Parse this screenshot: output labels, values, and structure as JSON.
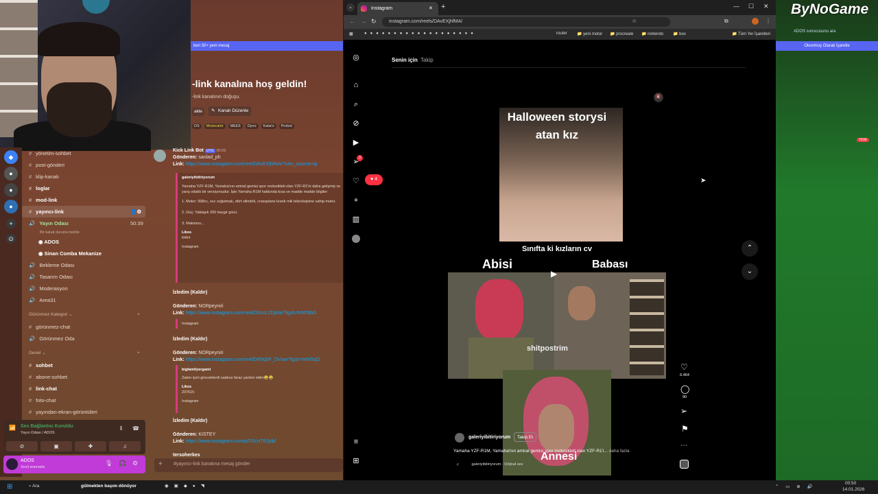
{
  "discord": {
    "welcome": "-link kanalına hoş geldin!",
    "welcome_sub": "-link kanalının doğuşu.",
    "banner": "beri 30+ yeni mesaj",
    "edit_channel": "Kanalı Düzenle",
    "edit_left": "akle",
    "tags": [
      "DS",
      "Moderatör",
      "MEE6",
      "Dyno",
      "Kalai's",
      "Probot"
    ],
    "channels": [
      {
        "name": "yönetim-sohbet",
        "bold": false
      },
      {
        "name": "post-gönderi",
        "bold": false
      },
      {
        "name": "klip-kanalı",
        "bold": false
      },
      {
        "name": "loglar",
        "bold": true
      },
      {
        "name": "mod-link",
        "bold": true
      },
      {
        "name": "yayıncı-link",
        "bold": true
      }
    ],
    "voice_channel": "Yayın Odası",
    "voice_time": "50:39",
    "voice_desc": "Bir kanal durumu belirle",
    "voice_users": [
      "ADOS",
      "Sinan Comba Mekanize"
    ],
    "channels2": [
      "Bekleme Odası",
      "Tasarım Odası",
      "Moderasyon",
      "Area31"
    ],
    "cat_hidden": "Görünmez Kategori",
    "channels3": [
      "görünmez-chat",
      "Görünmez Oda"
    ],
    "cat_general": "Genel",
    "channels4": [
      {
        "name": "sohbet",
        "bold": true
      },
      {
        "name": "abone-sohbet",
        "bold": false
      },
      {
        "name": "link-chat",
        "bold": true
      },
      {
        "name": "foto-chat",
        "bold": false
      },
      {
        "name": "yayından-ekran-görüntüleri",
        "bold": false
      }
    ],
    "voice_status": "Ses Bağlantısı Kuruldu",
    "voice_status_sub": "Yayın Odası / ADOS",
    "user": "ADOS",
    "user_status": "Sesli aramada",
    "msg_placeholder": "#yayıncı-link kanalına mesaj gönder",
    "messages": [
      {
        "bot": "Kick Link Bot",
        "badge": "UYG",
        "time": "00:09",
        "sender": "Gönderen:",
        "sender_name": "sanlad_ph",
        "link_label": "Link:",
        "link": "https://www.instagram.com/reel/DAvEXjhfMA/?utm_source=ig"
      },
      {
        "embed_author": "galeriyibitiriyorum",
        "embed_text": "Yamaha YZF-R1M, Yamaha'nın amiral gemisi spor motosikleti olan YZF-R1'in daha gelişmiş ve yarış odaklı bir versiyonudur. İşte Yamaha R1M hakkında kısa ve madde madde bilgiler:",
        "embed_p1": "1. Motor: 998cc, sıvı soğutmalı, dört silindirli, crossplane krank mili teknolojisine sahip motor.",
        "embed_p2": "2. Güç: Yaklaşık 200 beygir gücü.",
        "embed_p3": "3. Maksimu...",
        "likes_label": "Likes",
        "likes": "6464",
        "footer": "Instagram"
      },
      {
        "watched": "İzledim (Kaldır)",
        "sender": "Gönderen:",
        "sender_name": "NORpeyniri",
        "link_label": "Link:",
        "link": "https://www.instagram.com/reel/DSzcL2DjAte/?igsh=MW5lbG",
        "footer": "Instagram"
      },
      {
        "watched": "İzledim (Kaldır)",
        "sender": "Gönderen:",
        "sender_name": "NORpeyniri",
        "link_label": "Link:",
        "link": "https://www.instagram.com/reel/DR9q5F_DVsw/?igsh=MW5qO",
        "embed_author": "bigfamilyergami",
        "embed_text": "Zaten içeri gireceklerdi sadece biraz yardım ettim😂😂",
        "likes_label": "Likes",
        "likes": "207615",
        "footer": "Instagram"
      },
      {
        "watched": "İzledim (Kaldır)",
        "sender": "Gönderen:",
        "sender_name": "KISTEY",
        "link_label": "Link:",
        "link": "https://www.instagram.com/p/DScnT62jdb/",
        "next": "tersoherkes"
      }
    ]
  },
  "browser": {
    "tab_title": "Instagram",
    "url": "instagram.com/reels/DAvEXjhfMA/",
    "bookmarks": [
      "router",
      "yeni motor",
      "procreate",
      "nintendo",
      "box"
    ],
    "all_bookmarks": "Tüm Yer İşaretleri"
  },
  "instagram": {
    "tab_foryou": "Senin için",
    "tab_follow": "Takip",
    "notif_count": "4",
    "msg_badge": "3",
    "video_title_1": "Halloween storysi",
    "video_title_2": "atan kız",
    "caption_mid": "Sınıfta ki kızların cv",
    "label_abisi": "Abisi",
    "label_babasi": "Babası",
    "label_annesi": "Annesi",
    "watermark": "shitpostrim",
    "account": "galeriyibitiriyorum",
    "follow": "Takip Et",
    "caption": "Yamaha YZF-R1M, Yamaha'nın amiral gemisi spor motosikleti olan YZF-R1'i...",
    "more": "daha fazla",
    "audio": "galeriyibitiriyorum · Orijinal ses",
    "likes": "6.464",
    "comments": "90"
  },
  "right_panel": {
    "brand": "ByNoGame",
    "search": "ADOS sunucusunu ara",
    "mark_read": "Okunmuş Olarak İşaretle",
    "new_tag": "YENİ"
  },
  "taskbar": {
    "search": "Ara",
    "now_playing": "gülmekten başım dönüyor",
    "time": "00:50",
    "date": "14.01.2026"
  },
  "colors": {
    "discord_accent": "#5865f2",
    "ig_red": "#ff3040",
    "link": "#00a8fc",
    "bynogame_green": "#217a2b"
  }
}
